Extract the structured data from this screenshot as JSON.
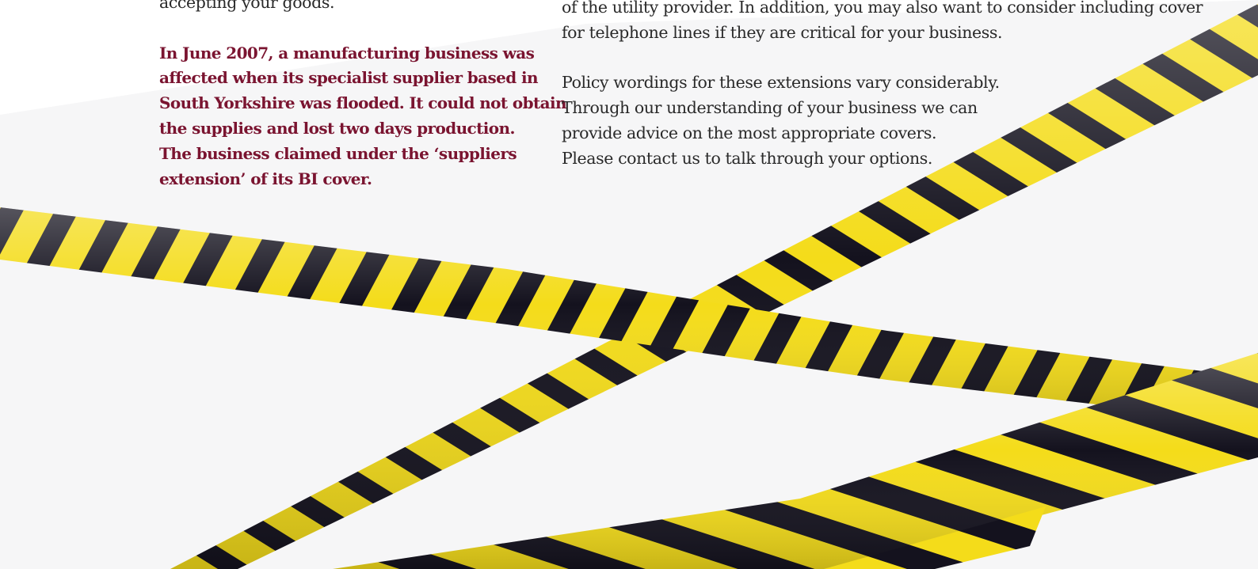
{
  "left_column": {
    "intro_tail": "accepting your goods.",
    "case_study_lines": [
      "In June 2007, a manufacturing business was",
      "affected when its specialist supplier based in",
      "South Yorkshire was flooded. It could not obtain",
      "the supplies and lost two days production.",
      "The business claimed under the ‘suppliers",
      "extension’ of its BI cover."
    ]
  },
  "right_column": {
    "utility_lines": [
      "of the utility provider. In addition, you may also want to consider including cover",
      "for telephone lines if they are critical for your business."
    ],
    "advice_lines": [
      "Policy wordings for these extensions vary considerably.",
      "Through our understanding of your business we can",
      "provide advice on the most appropriate covers.",
      "Please contact us to talk through your options."
    ]
  },
  "colors": {
    "body_text": "#2a2a2a",
    "case_study_text": "#7a1430",
    "tape_yellow": "#f4dc1a",
    "tape_black": "#14121e",
    "page_tint": "#f6f6f7"
  },
  "illustration": {
    "subject": "yellow-and-black-hazard-tape",
    "strands": 3
  }
}
